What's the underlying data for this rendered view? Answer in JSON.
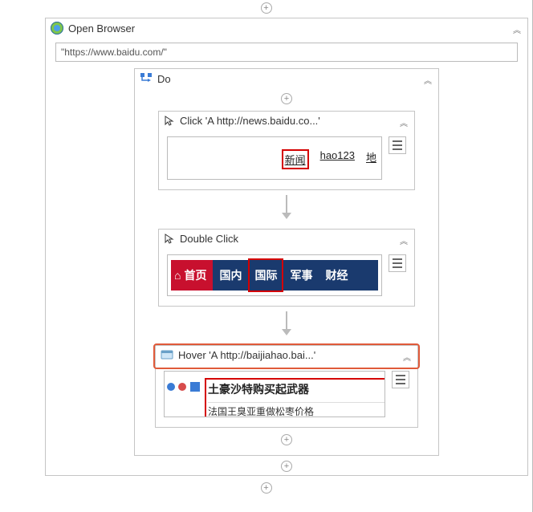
{
  "openBrowser": {
    "title": "Open Browser",
    "url": "\"https://www.baidu.com/\""
  },
  "do": {
    "title": "Do"
  },
  "click": {
    "title": "Click 'A  http://news.baidu.co...'",
    "links": {
      "news": "新闻",
      "hao123": "hao123",
      "map": "地"
    }
  },
  "doubleClick": {
    "title": "Double Click",
    "nav": {
      "home_icon": "⌂",
      "home": "首页",
      "domestic": "国内",
      "international": "国际",
      "military": "军事",
      "finance": "财经"
    }
  },
  "hover": {
    "title": "Hover 'A  http://baijiahao.bai...'",
    "headline": "土豪沙特购买起武器",
    "subline": "法国王臭亚重做松枣价格"
  }
}
